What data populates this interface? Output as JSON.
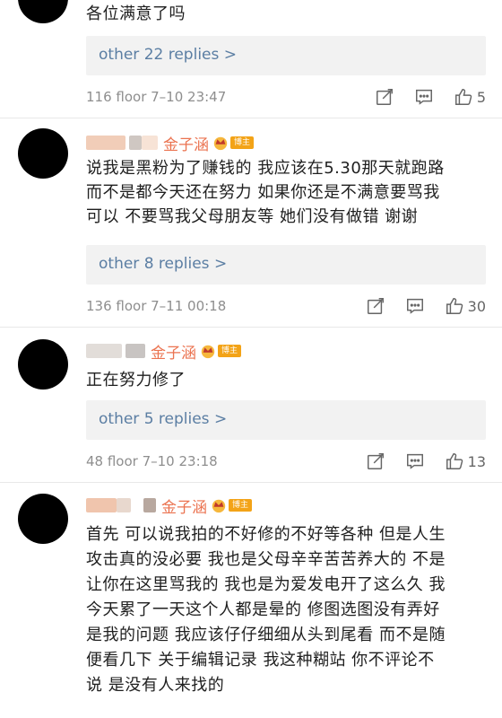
{
  "comments": [
    {
      "text_lines": [
        "各位满意了吗"
      ],
      "replies": "other 22 replies >",
      "floor": "116 floor  7–10 23:47",
      "likes": "5"
    },
    {
      "name": "金子涵",
      "badge": "博主",
      "text_lines": [
        "说我是黑粉为了赚钱的 我应该在5.30那天就跑路",
        "而不是都今天还在努力 如果你还是不满意要骂我",
        "可以 不要骂我父母朋友等 她们没有做错 谢谢"
      ],
      "replies": "other 8 replies >",
      "floor": "136 floor  7–11 00:18",
      "likes": "30"
    },
    {
      "name": "金子涵",
      "badge": "博主",
      "text_lines": [
        "正在努力修了"
      ],
      "replies": "other 5 replies >",
      "floor": "48 floor  7–10 23:18",
      "likes": "13"
    },
    {
      "name": "金子涵",
      "badge": "博主",
      "text_lines": [
        "首先 可以说我拍的不好修的不好等各种 但是人生",
        "攻击真的没必要 我也是父母辛辛苦苦养大的 不是",
        "让你在这里骂我的 我也是为爱发电开了这么久 我",
        "今天累了一天这个人都是晕的 修图选图没有弄好",
        "是我的问题 我应该仔仔细细从头到尾看 而不是随",
        "便看几下 关于编辑记录 我这种糊站 你不评论不",
        "说 是没有人来找的"
      ]
    }
  ],
  "colors": {
    "poster_name": "#eb7350",
    "reply_link": "#5b7ea3",
    "badge": "#f3a317"
  },
  "icons": [
    "edit-icon",
    "comment-icon",
    "thumbs-up-icon",
    "crown-icon"
  ]
}
